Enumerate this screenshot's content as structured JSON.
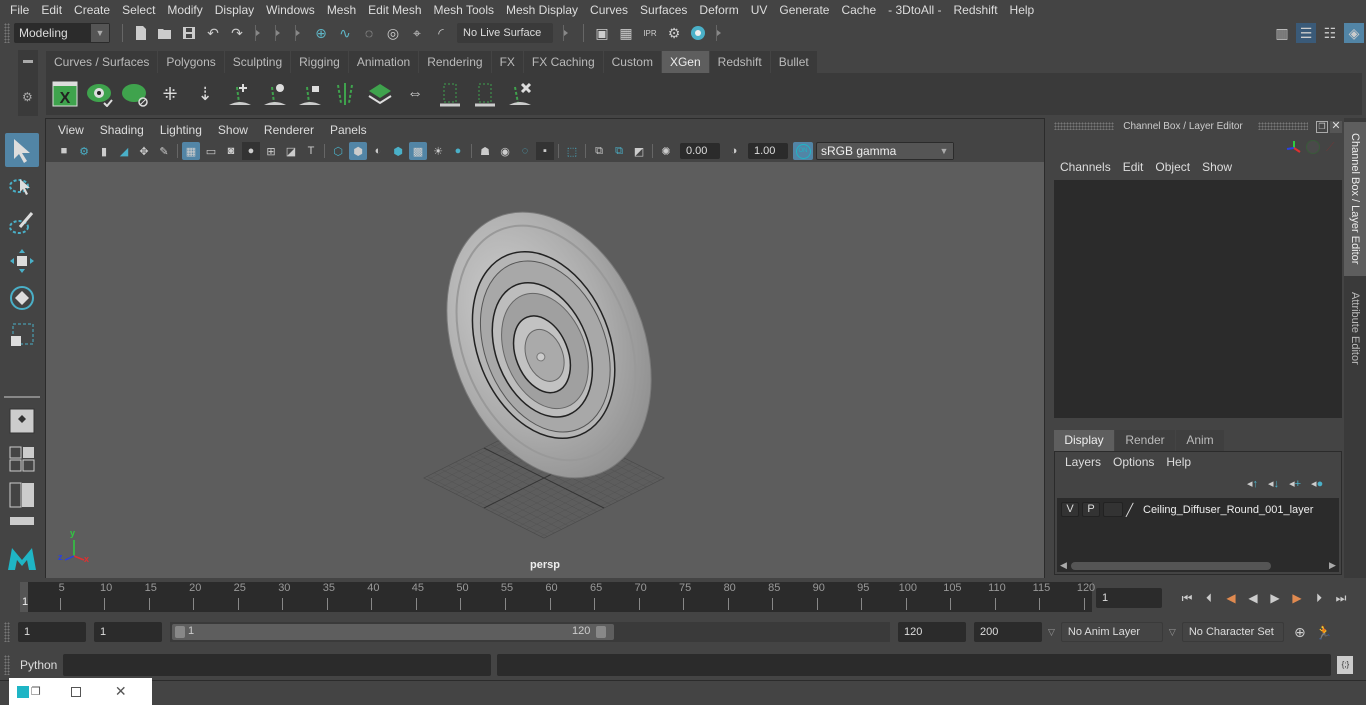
{
  "menubar": {
    "items": [
      "File",
      "Edit",
      "Create",
      "Select",
      "Modify",
      "Display",
      "Windows",
      "Mesh",
      "Edit Mesh",
      "Mesh Tools",
      "Mesh Display",
      "Curves",
      "Surfaces",
      "Deform",
      "UV",
      "Generate",
      "Cache",
      "- 3DtoAll -",
      "Redshift",
      "Help"
    ]
  },
  "statusline": {
    "mode": "Modeling",
    "live_surface": "No Live Surface"
  },
  "shelf": {
    "tabs": [
      "Curves / Surfaces",
      "Polygons",
      "Sculpting",
      "Rigging",
      "Animation",
      "Rendering",
      "FX",
      "FX Caching",
      "Custom",
      "XGen",
      "Redshift",
      "Bullet"
    ],
    "active_tab": "XGen",
    "icons": [
      "xgen-window-icon",
      "xgen-preview-icon",
      "xgen-clear-preview-icon",
      "add-guide-icon",
      "place-guide-icon",
      "add-guide-tool-icon",
      "guide-visibility-icon",
      "lock-guide-icon",
      "guides-icon",
      "patch-icon",
      "sculpt-guide-icon",
      "select-guides-icon",
      "guide-region-icon",
      "delete-guide-icon"
    ]
  },
  "viewport": {
    "menu": [
      "View",
      "Shading",
      "Lighting",
      "Show",
      "Renderer",
      "Panels"
    ],
    "exposure": "0.00",
    "gamma": "1.00",
    "color_space": "sRGB gamma",
    "color_mgmt_badge": "ON",
    "camera_label": "persp",
    "axis": {
      "x": "x",
      "y": "y",
      "z": "z"
    }
  },
  "channel_box": {
    "title": "Channel Box / Layer Editor",
    "menu": [
      "Channels",
      "Edit",
      "Object",
      "Show"
    ],
    "layer_tabs": [
      "Display",
      "Render",
      "Anim"
    ],
    "active_layer_tab": "Display",
    "layer_menu": [
      "Layers",
      "Options",
      "Help"
    ],
    "layers": [
      {
        "v": "V",
        "p": "P",
        "name": "Ceiling_Diffuser_Round_001_layer"
      }
    ]
  },
  "side_tabs": [
    "Channel Box / Layer Editor",
    "Attribute Editor"
  ],
  "timeline": {
    "ticks": [
      5,
      10,
      15,
      20,
      25,
      30,
      35,
      40,
      45,
      50,
      55,
      60,
      65,
      70,
      75,
      80,
      85,
      90,
      95,
      100,
      105,
      110,
      115,
      120
    ],
    "min": 1,
    "max": 120,
    "current_marker": "1",
    "current_frame": "1"
  },
  "range": {
    "start": "1",
    "playback_start": "1",
    "slider_start": "1",
    "slider_end": "120",
    "playback_end": "120",
    "end": "200",
    "anim_layer": "No Anim Layer",
    "character_set": "No Character Set"
  },
  "command": {
    "language": "Python",
    "input": "",
    "output": ""
  }
}
